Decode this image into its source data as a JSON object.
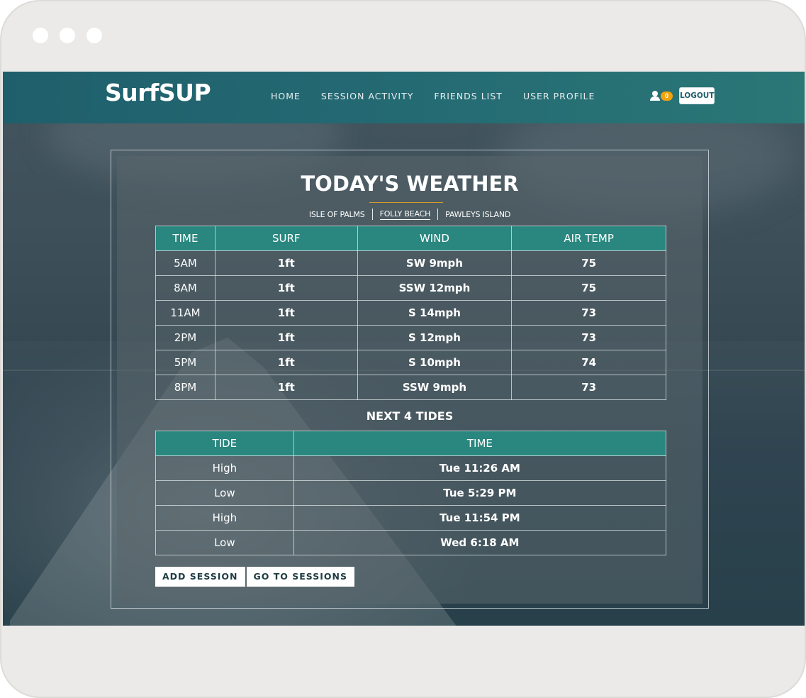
{
  "header": {
    "logo": "SurfSUP",
    "nav": [
      "HOME",
      "SESSION ACTIVITY",
      "FRIENDS LIST",
      "USER PROFILE"
    ],
    "notification_count": "0",
    "logout_label": "LOGOUT",
    "user_icon": "user-icon"
  },
  "weather": {
    "title": "TODAY'S WEATHER",
    "locations": [
      "ISLE OF PALMS",
      "FOLLY BEACH",
      "PAWLEYS ISLAND"
    ],
    "active_location": "FOLLY BEACH",
    "columns": [
      "TIME",
      "SURF",
      "WIND",
      "AIR TEMP"
    ],
    "rows": [
      [
        "5AM",
        "1ft",
        "SW 9mph",
        "75"
      ],
      [
        "8AM",
        "1ft",
        "SSW 12mph",
        "75"
      ],
      [
        "11AM",
        "1ft",
        "S 14mph",
        "73"
      ],
      [
        "2PM",
        "1ft",
        "S 12mph",
        "73"
      ],
      [
        "5PM",
        "1ft",
        "S 10mph",
        "74"
      ],
      [
        "8PM",
        "1ft",
        "SSW 9mph",
        "73"
      ]
    ]
  },
  "tides": {
    "title": "NEXT 4 TIDES",
    "columns": [
      "TIDE",
      "TIME"
    ],
    "rows": [
      [
        "High",
        "Tue 11:26 AM"
      ],
      [
        "Low",
        "Tue 5:29 PM"
      ],
      [
        "High",
        "Tue 11:54 PM"
      ],
      [
        "Low",
        "Wed 6:18 AM"
      ]
    ]
  },
  "actions": {
    "add_session": "ADD SESSION",
    "go_to_sessions": "GO TO SESSIONS"
  },
  "colors": {
    "header": "#246a73",
    "table_header": "#2a877f",
    "badge": "#f2a20a",
    "title_accent": "#d79b28"
  }
}
